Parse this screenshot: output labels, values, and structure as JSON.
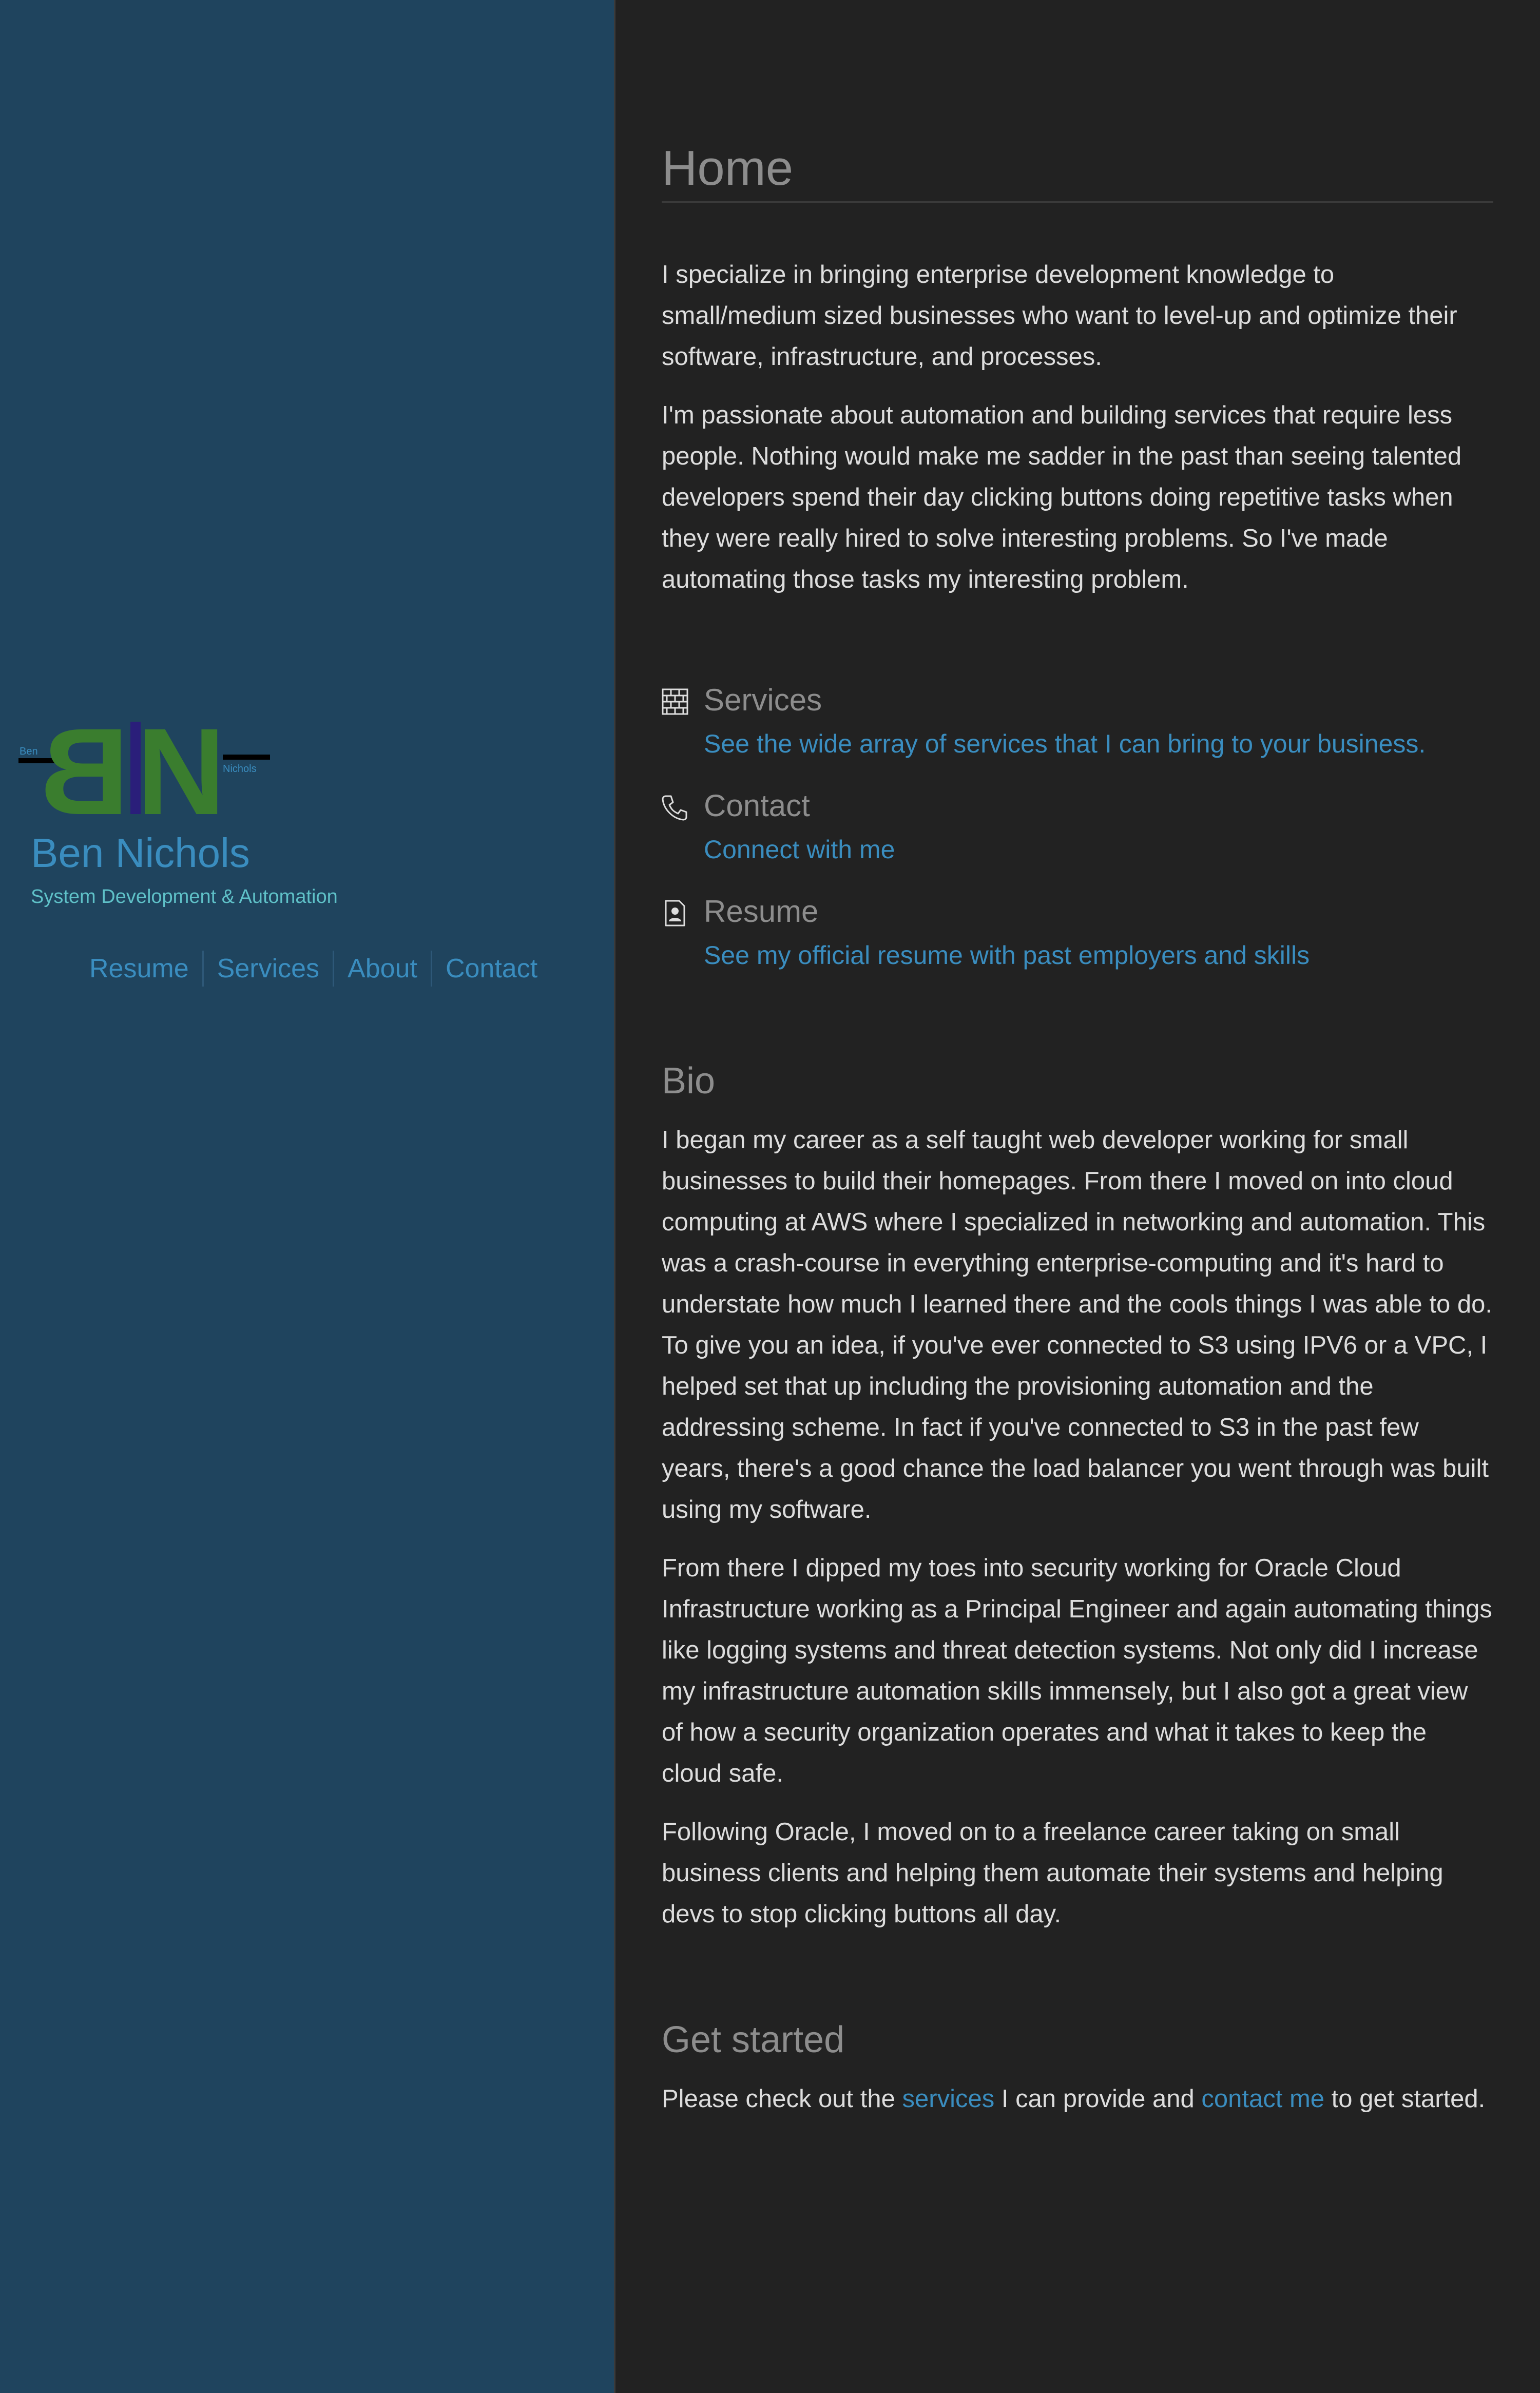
{
  "sidebar": {
    "logo": {
      "letters": "BN",
      "small_left": "Ben",
      "small_right": "Nichols",
      "colors": {
        "letters": "#3a7d2e",
        "bar": "#2a1e7a",
        "lines": "#000000",
        "small_text": "#3a8dbf"
      }
    },
    "title": "Ben Nichols",
    "tagline": "System Development & Automation",
    "nav": [
      {
        "label": "Resume"
      },
      {
        "label": "Services"
      },
      {
        "label": "About"
      },
      {
        "label": "Contact"
      }
    ]
  },
  "main": {
    "title": "Home",
    "intro": [
      "I specialize in bringing enterprise development knowledge to small/medium sized businesses who want to level-up and optimize their software, infrastructure, and processes.",
      "I'm passionate about automation and building services that require less people. Nothing would make me sadder in the past than seeing talented developers spend their day clicking buttons doing repetitive tasks when they were really hired to solve interesting problems. So I've made automating those tasks my interesting problem."
    ],
    "links": [
      {
        "icon": "brick-wall-icon",
        "title": "Services",
        "desc": "See the wide array of services that I can bring to your business."
      },
      {
        "icon": "phone-icon",
        "title": "Contact",
        "desc": "Connect with me"
      },
      {
        "icon": "resume-document-icon",
        "title": "Resume",
        "desc": "See my official resume with past employers and skills"
      }
    ],
    "bio": {
      "heading": "Bio",
      "paragraphs": [
        "I began my career as a self taught web developer working for small businesses to build their homepages. From there I moved on into cloud computing at AWS where I specialized in networking and automation. This was a crash-course in everything enterprise-computing and it's hard to understate how much I learned there and the cools things I was able to do. To give you an idea, if you've ever connected to S3 using IPV6 or a VPC, I helped set that up including the provisioning automation and the addressing scheme. In fact if you've connected to S3 in the past few years, there's a good chance the load balancer you went through was built using my software.",
        "From there I dipped my toes into security working for Oracle Cloud Infrastructure working as a Principal Engineer and again automating things like logging systems and threat detection systems. Not only did I increase my infrastructure automation skills immensely, but I also got a great view of how a security organization operates and what it takes to keep the cloud safe.",
        "Following Oracle, I moved on to a freelance career taking on small business clients and helping them automate their systems and helping devs to stop clicking buttons all day."
      ]
    },
    "get_started": {
      "heading": "Get started",
      "text_1": "Please check out the ",
      "link_1": "services",
      "text_2": " I can provide and ",
      "link_2": "contact me",
      "text_3": " to get started."
    }
  },
  "colors": {
    "sidebar_bg": "#1f445e",
    "main_bg": "#222222",
    "link": "#3a8dbf",
    "heading": "#8d8d8d",
    "text": "#dddddd",
    "tagline": "#5fc1c8"
  }
}
